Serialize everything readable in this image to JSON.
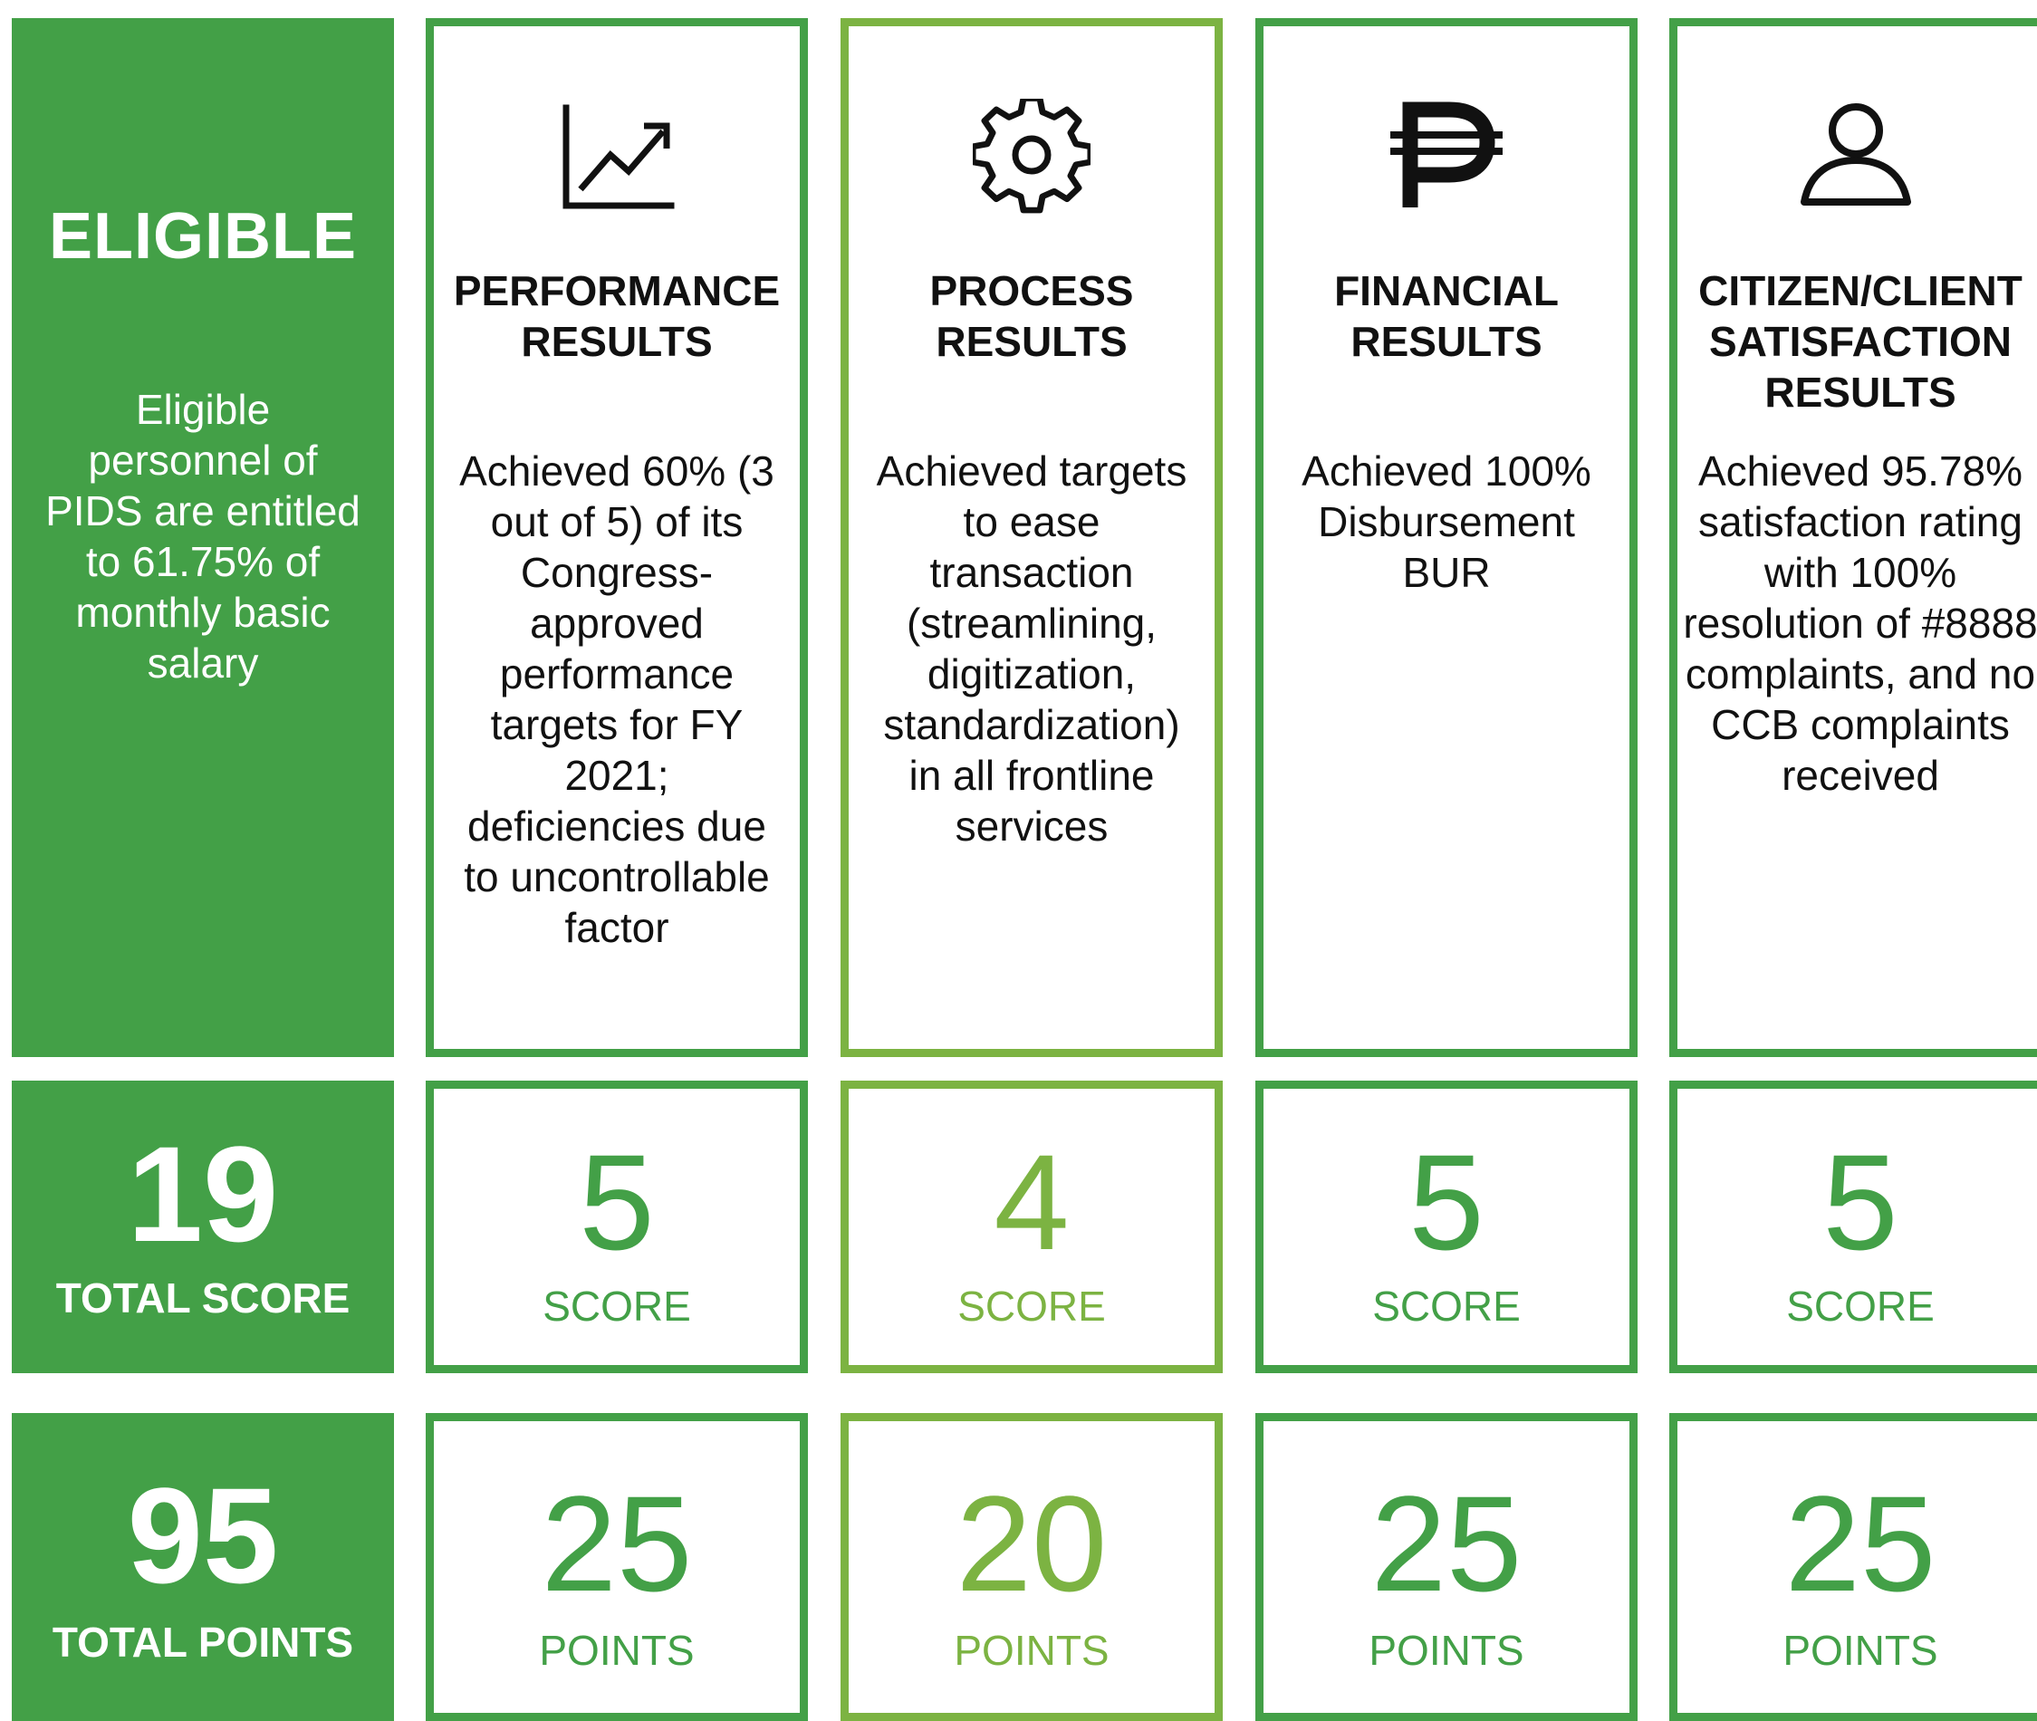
{
  "summary": {
    "title": "ELIGIBLE",
    "description": "Eligible personnel of PIDS are entitled to 61.75% of monthly basic salary",
    "total_score": "19",
    "total_score_label": "TOTAL SCORE",
    "total_points": "95",
    "total_points_label": "TOTAL POINTS"
  },
  "categories": [
    {
      "icon": "chart-growth-icon",
      "title": "PERFORMANCE RESULTS",
      "description": "Achieved 60% (3 out of 5) of its Congress-approved performance targets for FY 2021; deficiencies due to uncontrollable factor",
      "score": "5",
      "score_label": "SCORE",
      "points": "25",
      "points_label": "POINTS"
    },
    {
      "icon": "gear-icon",
      "title": "PROCESS RESULTS",
      "description": "Achieved targets to ease transaction (streamlining, digitization, standardization) in all frontline services",
      "score": "4",
      "score_label": "SCORE",
      "points": "20",
      "points_label": "POINTS"
    },
    {
      "icon": "peso-icon",
      "title": "FINANCIAL RESULTS",
      "description": "Achieved 100% Disbursement BUR",
      "score": "5",
      "score_label": "SCORE",
      "points": "25",
      "points_label": "POINTS"
    },
    {
      "icon": "person-icon",
      "title": "CITIZEN/CLIENT SATISFACTION RESULTS",
      "description": "Achieved 95.78% satisfaction rating with 100% resolution of #8888 complaints, and no CCB complaints received",
      "score": "5",
      "score_label": "SCORE",
      "points": "25",
      "points_label": "POINTS"
    }
  ],
  "colors": {
    "green": "#43a047",
    "light_green": "#7cb342"
  }
}
